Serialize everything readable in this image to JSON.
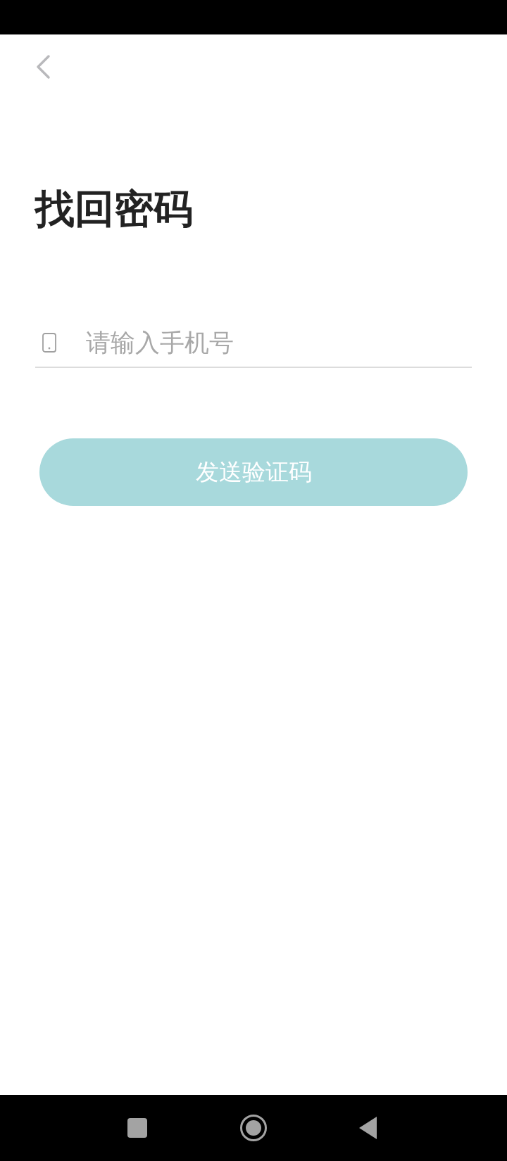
{
  "title": "找回密码",
  "phone_field": {
    "placeholder": "请输入手机号"
  },
  "send_button": {
    "label": "发送验证码"
  }
}
